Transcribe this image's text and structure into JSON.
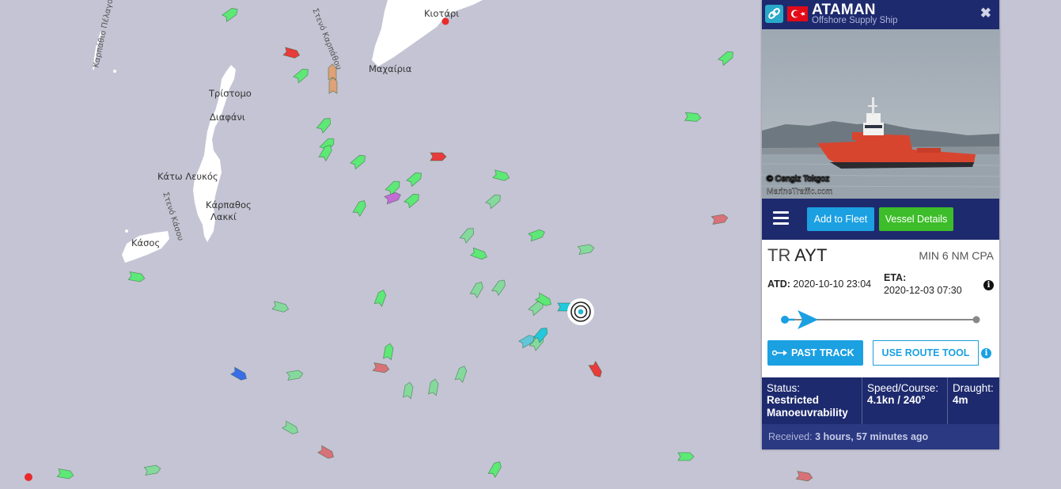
{
  "map": {
    "labels": [
      {
        "text": "Κιοτάρι",
        "name": "label-kiotari"
      },
      {
        "text": "Μαχαίρια",
        "name": "label-machairia"
      },
      {
        "text": "Τρίστομο",
        "name": "label-tristomo"
      },
      {
        "text": "Διαφάνι",
        "name": "label-diafani"
      },
      {
        "text": "Κάτω Λευκός",
        "name": "label-kato-lefkos"
      },
      {
        "text": "Κάρπαθος",
        "name": "label-karpathos"
      },
      {
        "text": "Λακκί",
        "name": "label-lakki"
      },
      {
        "text": "Κάσος",
        "name": "label-kasos"
      }
    ],
    "sea_labels": [
      {
        "text": "Καρπάθιο Πέλαγος",
        "name": "label-karpathio-pelagos"
      },
      {
        "text": "Στενό Καρπάθου",
        "name": "label-steno-karpathou"
      },
      {
        "text": "Στενό Κάσου",
        "name": "label-steno-kasou"
      }
    ],
    "colors": {
      "sea": "#c4c4d4",
      "land": "#ffffff",
      "cargo": "#5ee876",
      "tanker": "#e83b3b",
      "passenger": "#3a6de8",
      "selected_marker": "#22b8d6"
    }
  },
  "vessel": {
    "name": "ATAMAN",
    "type": "Offshore Supply Ship",
    "flag": "Turkey",
    "close_label": "✖",
    "photo_credit": "© Cengiz Tokgoz",
    "photo_site": "MarineTraffic.com",
    "add_to_fleet": "Add to Fleet",
    "vessel_details": "Vessel Details",
    "destination_prefix": "TR",
    "destination_port": "AYT",
    "cpa": "MIN 6 NM CPA",
    "atd_label": "ATD:",
    "atd_value": "2020-10-10 23:04",
    "eta_label": "ETA:",
    "eta_value": "2020-12-03 07:30",
    "info_icon": "i",
    "progress_fraction": 0.05,
    "past_track": "PAST TRACK",
    "route_tool": "USE ROUTE TOOL",
    "status_label": "Status:",
    "status_value": "Restricted Manoeuvrability",
    "speed_label": "Speed/Course:",
    "speed_value": "4.1kn / 240°",
    "draught_label": "Draught:",
    "draught_value": "4m",
    "received_label": "Received:",
    "received_value": "3 hours, 57 minutes ago"
  }
}
